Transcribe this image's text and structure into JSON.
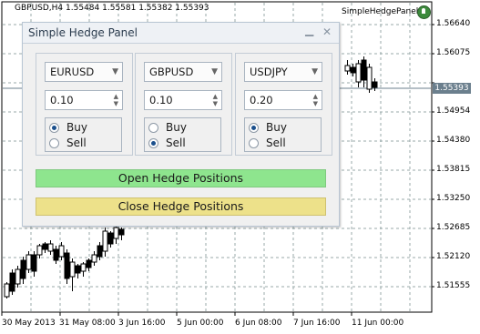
{
  "chart": {
    "header_symbol": "GBPUSD,H4",
    "header_prices": "1.55484 1.55581 1.55382 1.55393",
    "ea_name": "SimpleHedgePanel",
    "current_price": "1.55393",
    "y_labels": [
      "1.56640",
      "1.56075",
      "1.54954",
      "1.54380",
      "1.53815",
      "1.53250",
      "1.52685",
      "1.52120",
      "1.51555"
    ],
    "x_labels": [
      "30 May 2013",
      "31 May 08:00",
      "3 Jun 16:00",
      "5 Jun 00:00",
      "6 Jun 08:00",
      "7 Jun 16:00",
      "11 Jun 00:00"
    ]
  },
  "panel": {
    "title": "Simple Hedge Panel",
    "minimize_glyph": "▁",
    "close_glyph": "✕",
    "groups": [
      {
        "symbol": "EURUSD",
        "lot": "0.10",
        "buy_label": "Buy",
        "sell_label": "Sell",
        "selected": "buy"
      },
      {
        "symbol": "GBPUSD",
        "lot": "0.10",
        "buy_label": "Buy",
        "sell_label": "Sell",
        "selected": "sell"
      },
      {
        "symbol": "USDJPY",
        "lot": "0.20",
        "buy_label": "Buy",
        "sell_label": "Sell",
        "selected": "buy"
      }
    ],
    "open_button": "Open Hedge Positions",
    "close_button": "Close Hedge Positions"
  },
  "colors": {
    "open_button": "#8ee58e",
    "close_button": "#ede18a",
    "price_tag": "#6b7f8d"
  }
}
